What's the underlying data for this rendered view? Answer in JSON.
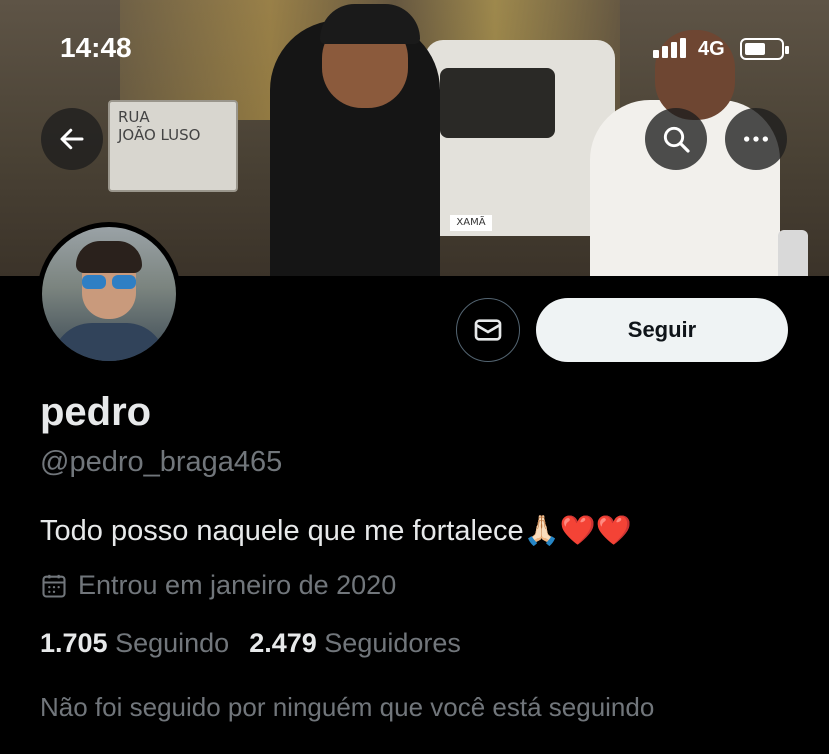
{
  "status_bar": {
    "time": "14:48",
    "network": "4G"
  },
  "banner": {
    "sign_text_line1": "RUA",
    "sign_text_line2": "JOÃO LUSO",
    "plate_text": "XAMÃ"
  },
  "nav": {
    "back_icon": "arrow-left-icon",
    "search_icon": "search-icon",
    "more_icon": "more-icon"
  },
  "profile": {
    "name": "pedro",
    "handle": "@pedro_braga465",
    "bio": "Todo posso naquele que me fortalece🙏🏻❤️❤️",
    "joined": "Entrou em janeiro de 2020",
    "following_count": "1.705",
    "following_label": "Seguindo",
    "followers_count": "2.479",
    "followers_label": "Seguidores",
    "followed_by_note": "Não foi seguido por ninguém que você está seguindo"
  },
  "actions": {
    "follow_label": "Seguir",
    "message_icon": "mail-icon"
  },
  "colors": {
    "background": "#000000",
    "primary_text": "#e7e9ea",
    "secondary_text": "#71767b",
    "follow_button_bg": "#eff3f4"
  }
}
